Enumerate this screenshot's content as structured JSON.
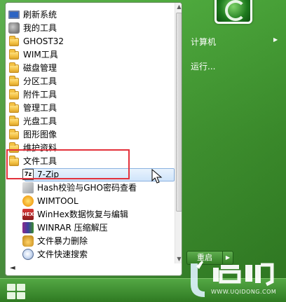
{
  "menu": {
    "items": [
      {
        "label": "刷新系统",
        "icon": "monitor-icon"
      },
      {
        "label": "我的工具",
        "icon": "tools-icon"
      },
      {
        "label": "GHOST32",
        "icon": "folder-icon"
      },
      {
        "label": "WIM工具",
        "icon": "folder-icon"
      },
      {
        "label": "磁盘管理",
        "icon": "folder-icon"
      },
      {
        "label": "分区工具",
        "icon": "folder-icon"
      },
      {
        "label": "附件工具",
        "icon": "folder-icon"
      },
      {
        "label": "管理工具",
        "icon": "folder-icon"
      },
      {
        "label": "光盘工具",
        "icon": "folder-icon"
      },
      {
        "label": "图形图像",
        "icon": "folder-icon"
      },
      {
        "label": "维护资料",
        "icon": "folder-icon"
      },
      {
        "label": "文件工具",
        "icon": "folder-icon"
      }
    ],
    "sub_items": [
      {
        "label": "7-Zip",
        "icon": "7zip-icon"
      },
      {
        "label": "Hash校验与GHO密码查看",
        "icon": "hash-icon"
      },
      {
        "label": "WIMTOOL",
        "icon": "wimtool-icon"
      },
      {
        "label": "WinHex数据恢复与编辑",
        "icon": "winhex-icon"
      },
      {
        "label": "WINRAR 压缩解压",
        "icon": "winrar-icon"
      },
      {
        "label": "文件暴力删除",
        "icon": "lock-icon"
      },
      {
        "label": "文件快速搜索",
        "icon": "search-icon"
      }
    ],
    "back_arrow": "◄",
    "zip_glyph": "7z",
    "hex_glyph": "HEX"
  },
  "right_pane": {
    "computer": "计算机",
    "run": "运行...",
    "shutdown": "重启"
  },
  "watermark": {
    "url": "WWW.UQIDONG.COM"
  },
  "colors": {
    "highlight_border": "#e3313b",
    "selection_fill": "#cfe4fa",
    "theme_green": "#3c8f2c"
  }
}
